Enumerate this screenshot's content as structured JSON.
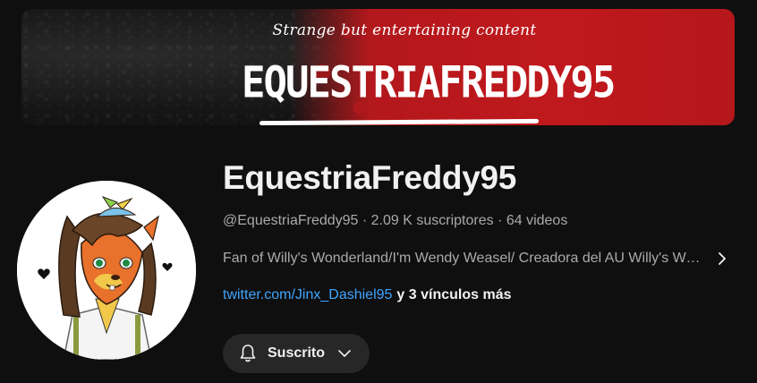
{
  "banner": {
    "tagline": "Strange but entertaining content",
    "logo_text": "EQUESTRIAFREDDY95"
  },
  "channel": {
    "name": "EquestriaFreddy95",
    "meta": "@EquestriaFreddy95 · 2.09 K suscriptores · 64 videos",
    "description": "Fan of Willy's Wonderland/I'm Wendy Weasel/ Creadora del AU Willy's Wonderland Deluxe",
    "link": "twitter.com/Jinx_Dashiel95",
    "more_links": "y 3 vínculos más"
  },
  "subscribe": {
    "label": "Suscrito"
  },
  "icons": {
    "description_more": "chevron-right-icon",
    "bell": "bell-icon",
    "dropdown": "chevron-down-icon"
  },
  "colors": {
    "background": "#0f0f0f",
    "banner_red": "#c0191d",
    "link": "#3ea6ff",
    "button_bg": "#272727",
    "secondary_text": "#aaaaaa"
  }
}
